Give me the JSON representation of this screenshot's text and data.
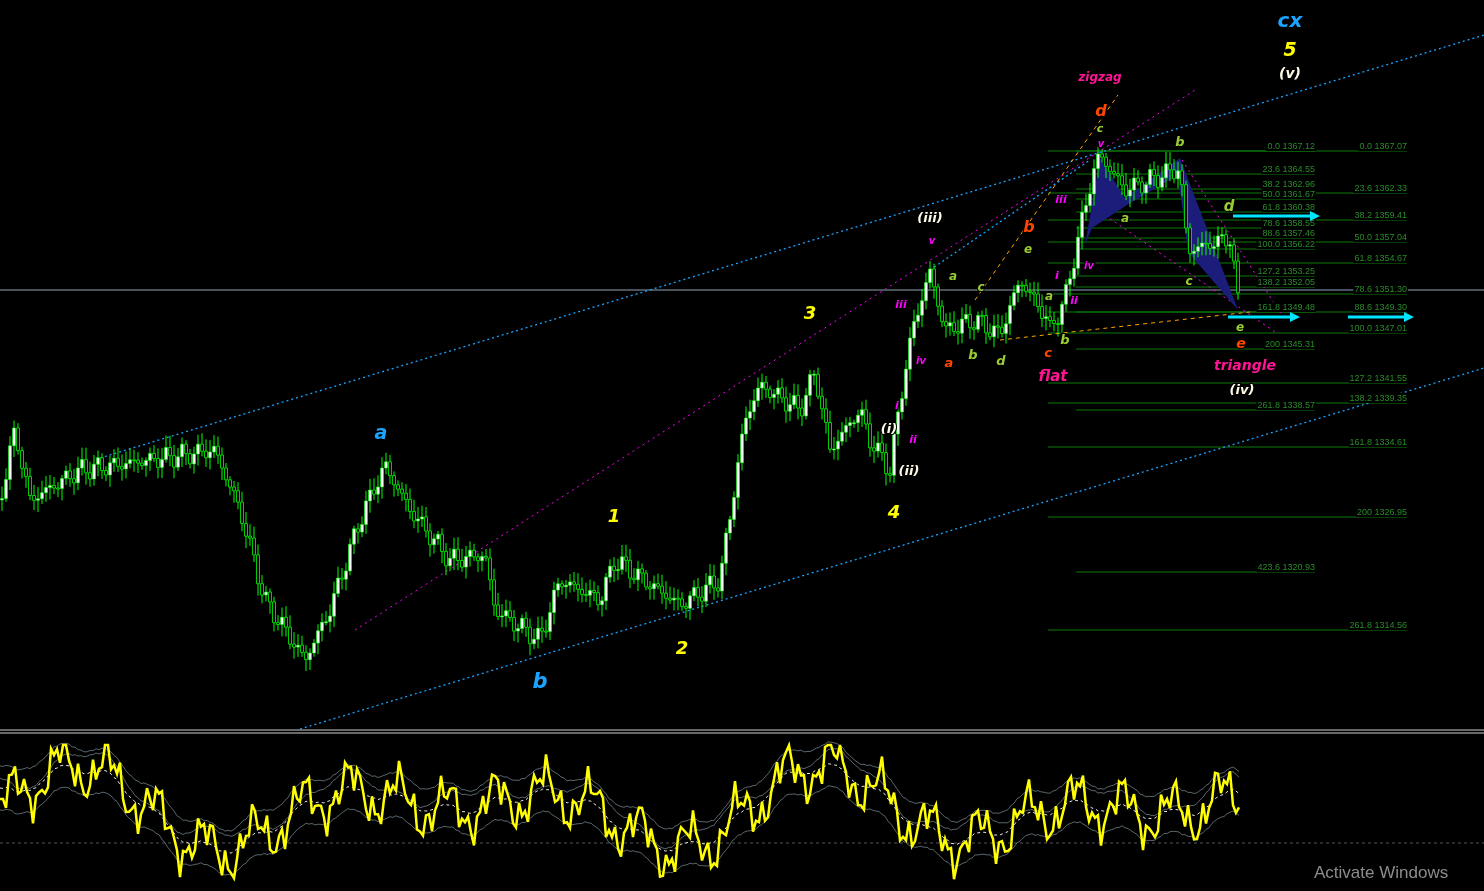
{
  "wave_labels": [
    {
      "text": "cx",
      "color": "#1aa3ff"
    },
    {
      "text": "5",
      "color": "#ffff00"
    },
    {
      "text": "(v)",
      "color": "#fffbe6"
    },
    {
      "text": "zigzag",
      "color": "#ff1493"
    },
    {
      "text": "d",
      "color": "#ff4500"
    },
    {
      "text": "c",
      "color": "#9acd32"
    },
    {
      "text": "b",
      "color": "#9acd32"
    },
    {
      "text": "v",
      "color": "#ff00ff"
    },
    {
      "text": "iii",
      "color": "#ff00ff"
    },
    {
      "text": "d",
      "color": "#9acd32"
    },
    {
      "text": "(iii)",
      "color": "#fffbe6"
    },
    {
      "text": "a",
      "color": "#9acd32"
    },
    {
      "text": "b",
      "color": "#ff4500"
    },
    {
      "text": "v",
      "color": "#ff00ff"
    },
    {
      "text": "e",
      "color": "#9acd32"
    },
    {
      "text": "iv",
      "color": "#ff00ff"
    },
    {
      "text": "a",
      "color": "#9acd32"
    },
    {
      "text": "c",
      "color": "#9acd32"
    },
    {
      "text": "i",
      "color": "#ff00ff"
    },
    {
      "text": "c",
      "color": "#9acd32"
    },
    {
      "text": "a",
      "color": "#9acd32"
    },
    {
      "text": "ii",
      "color": "#ff00ff"
    },
    {
      "text": "3",
      "color": "#ffff00"
    },
    {
      "text": "iii",
      "color": "#ff00ff"
    },
    {
      "text": "b",
      "color": "#9acd32"
    },
    {
      "text": "e",
      "color": "#9acd32"
    },
    {
      "text": "e",
      "color": "#ff4500"
    },
    {
      "text": "iv",
      "color": "#ff00ff"
    },
    {
      "text": "a",
      "color": "#ff4500"
    },
    {
      "text": "b",
      "color": "#9acd32"
    },
    {
      "text": "d",
      "color": "#9acd32"
    },
    {
      "text": "c",
      "color": "#ff4500"
    },
    {
      "text": "triangle",
      "color": "#ff1493"
    },
    {
      "text": "flat",
      "color": "#ff1493"
    },
    {
      "text": "(iv)",
      "color": "#fffbe6"
    },
    {
      "text": "i",
      "color": "#ff00ff"
    },
    {
      "text": "(i)",
      "color": "#fffbe6"
    },
    {
      "text": "a",
      "color": "#1aa3ff"
    },
    {
      "text": "ii",
      "color": "#ff00ff"
    },
    {
      "text": "(ii)",
      "color": "#fffbe6"
    },
    {
      "text": "4",
      "color": "#ffff00"
    },
    {
      "text": "1",
      "color": "#ffff00"
    },
    {
      "text": "2",
      "color": "#ffff00"
    },
    {
      "text": "b",
      "color": "#1aa3ff"
    }
  ],
  "fib_levels_left": [
    "0.0 1367.12",
    "23.6 1364.55",
    "38.2 1362.96",
    "50.0 1361.67",
    "61.8 1360.38",
    "78.6 1358.55",
    "88.6 1357.46",
    "100.0 1356.22",
    "127.2 1353.25",
    "138.2 1352.05",
    "161.8 1349.48",
    "200 1345.31",
    "261.8 1338.57",
    "423.6 1320.93"
  ],
  "fib_levels_right": [
    "0.0 1367.07",
    "23.6 1362.33",
    "38.2 1359.41",
    "50.0 1357.04",
    "61.8 1354.67",
    "78.6 1351.30",
    "88.6 1349.30",
    "100.0 1347.01",
    "127.2 1341.55",
    "138.2 1339.35",
    "161.8 1334.61",
    "200 1326.95",
    "261.8 1314.56"
  ],
  "os_notice": "Activate Windows"
}
